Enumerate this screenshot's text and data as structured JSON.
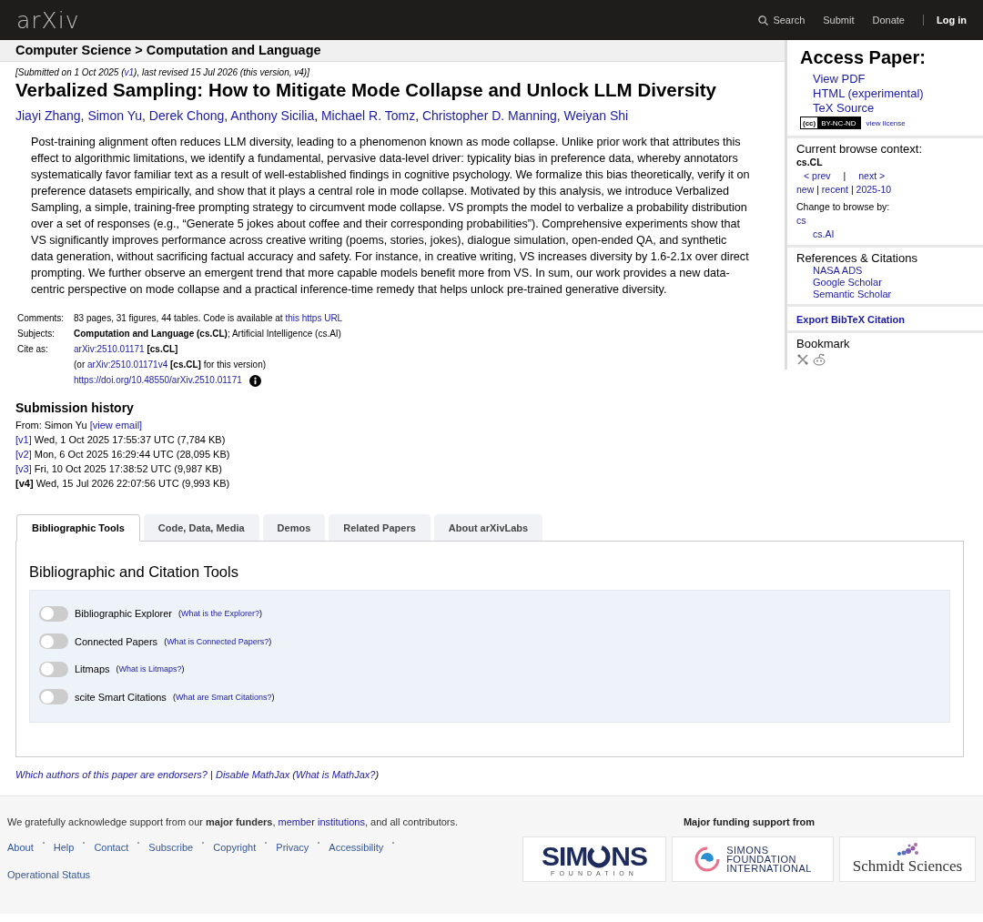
{
  "header": {
    "logo": "arXiv",
    "nav": [
      {
        "label": "Search",
        "kind": "search"
      },
      {
        "label": "Submit",
        "kind": "link"
      },
      {
        "label": "Donate",
        "kind": "link"
      },
      {
        "label": "Log in",
        "kind": "login"
      }
    ]
  },
  "breadcrumb": "Computer Science > Computation and Language",
  "submitted": [
    {
      "kind": "text",
      "text": "[Submitted on 1 Oct 2025 ("
    },
    {
      "kind": "link",
      "text": "v1"
    },
    {
      "kind": "text",
      "text": "), last revised 15 Jul 2026 (this version, v4)]"
    }
  ],
  "title": "Verbalized Sampling: How to Mitigate Mode Collapse and Unlock LLM Diversity",
  "authors": [
    {
      "kind": "link",
      "text": "Jiayi Zhang"
    },
    {
      "kind": "text",
      "text": ", "
    },
    {
      "kind": "link",
      "text": "Simon Yu"
    },
    {
      "kind": "text",
      "text": ", "
    },
    {
      "kind": "link",
      "text": "Derek Chong"
    },
    {
      "kind": "text",
      "text": ", "
    },
    {
      "kind": "link",
      "text": "Anthony Sicilia"
    },
    {
      "kind": "text",
      "text": ", "
    },
    {
      "kind": "link",
      "text": "Michael R. Tomz"
    },
    {
      "kind": "text",
      "text": ", "
    },
    {
      "kind": "link",
      "text": "Christopher D. Manning"
    },
    {
      "kind": "text",
      "text": ", "
    },
    {
      "kind": "link",
      "text": "Weiyan Shi"
    }
  ],
  "abstract": "Post-training alignment often reduces LLM diversity, leading to a phenomenon known as mode collapse. Unlike prior work that attributes this effect to algorithmic limitations, we identify a fundamental, pervasive data-level driver: typicality bias in preference data, whereby annotators systematically favor familiar text as a result of well-established findings in cognitive psychology. We formalize this bias theoretically, verify it on preference datasets empirically, and show that it plays a central role in mode collapse. Motivated by this analysis, we introduce Verbalized Sampling, a simple, training-free prompting strategy to circumvent mode collapse. VS prompts the model to verbalize a probability distribution over a set of responses (e.g., “Generate 5 jokes about coffee and their corresponding probabilities”). Comprehensive experiments show that VS significantly improves performance across creative writing (poems, stories, jokes), dialogue simulation, open-ended QA, and synthetic data generation, without sacrificing factual accuracy and safety. For instance, in creative writing, VS increases diversity by 1.6-2.1x over direct prompting. We further observe an emergent trend that more capable models benefit more from VS. In sum, our work provides a new data-centric perspective on mode collapse and a practical inference-time remedy that helps unlock pre-trained generative diversity.",
  "metadata": [
    {
      "label": "Comments:",
      "lines": [
        [
          {
            "kind": "text",
            "text": "83 pages, 31 figures, 44 tables. Code is available at "
          },
          {
            "kind": "link",
            "text": "this https URL"
          }
        ]
      ]
    },
    {
      "label": "Subjects:",
      "lines": [
        [
          {
            "kind": "text",
            "text": "**Computation and Language (cs.CL)**; Artificial Intelligence (cs.AI)"
          }
        ]
      ]
    },
    {
      "label": "Cite as:",
      "lines": [
        [
          {
            "kind": "link",
            "text": "arXiv:2510.01171"
          },
          {
            "kind": "text",
            "text": " **[cs.CL]**"
          }
        ],
        [
          {
            "kind": "text",
            "text": "(or "
          },
          {
            "kind": "link",
            "text": "arXiv:2510.01171v4"
          },
          {
            "kind": "text",
            "text": " **[cs.CL]** for this version)"
          }
        ],
        [
          {
            "kind": "link",
            "text": "https://doi.org/10.48550/arXiv.2510.01171"
          },
          {
            "kind": "info"
          }
        ]
      ]
    }
  ],
  "history": {
    "title": "Submission history",
    "from": [
      {
        "kind": "text",
        "text": "From: Simon Yu "
      },
      {
        "kind": "link",
        "text": "[view email]"
      }
    ],
    "versions": [
      {
        "version": "[v1]",
        "current": false,
        "details": "Wed, 1 Oct 2025 17:55:37 UTC (7,784 KB)"
      },
      {
        "version": "[v2]",
        "current": false,
        "details": "Mon, 6 Oct 2025 16:29:44 UTC (28,095 KB)"
      },
      {
        "version": "[v3]",
        "current": false,
        "details": "Fri, 10 Oct 2025 17:38:52 UTC (9,987 KB)"
      },
      {
        "version": "[v4]",
        "current": true,
        "details": "Wed, 15 Jul 2026 22:07:56 UTC (9,993 KB)"
      }
    ]
  },
  "tabs": [
    {
      "label": "Bibliographic Tools",
      "selected": true
    },
    {
      "label": "Code, Data, Media",
      "selected": false
    },
    {
      "label": "Demos",
      "selected": false
    },
    {
      "label": "Related Papers",
      "selected": false
    },
    {
      "label": "About arXivLabs",
      "selected": false
    }
  ],
  "tools": {
    "title": "Bibliographic and Citation Tools",
    "items": [
      {
        "name": "Bibliographic Explorer",
        "help": [
          {
            "kind": "text",
            "text": "("
          },
          {
            "kind": "link",
            "text": "What is the Explorer?"
          },
          {
            "kind": "text",
            "text": ")"
          }
        ],
        "on": false
      },
      {
        "name": "Connected Papers",
        "help": [
          {
            "kind": "text",
            "text": "("
          },
          {
            "kind": "link",
            "text": "What is Connected Papers?"
          },
          {
            "kind": "text",
            "text": ")"
          }
        ],
        "on": false
      },
      {
        "name": "Litmaps",
        "help": [
          {
            "kind": "text",
            "text": "("
          },
          {
            "kind": "link",
            "text": "What is Litmaps?"
          },
          {
            "kind": "text",
            "text": ")"
          }
        ],
        "on": false
      },
      {
        "name": "scite Smart Citations",
        "help": [
          {
            "kind": "text",
            "text": "("
          },
          {
            "kind": "link",
            "text": "What are Smart Citations?"
          },
          {
            "kind": "text",
            "text": ")"
          }
        ],
        "on": false
      }
    ]
  },
  "bottom_links": [
    {
      "kind": "link",
      "text": "Which authors of this paper are endorsers?"
    },
    {
      "kind": "text",
      "text": " | "
    },
    {
      "kind": "link",
      "text": "Disable MathJax"
    },
    {
      "kind": "text",
      "text": " ("
    },
    {
      "kind": "link",
      "text": "What is MathJax?"
    },
    {
      "kind": "text",
      "text": ")"
    }
  ],
  "sidebar": {
    "access": {
      "title": "Access Paper:",
      "links": [
        "View PDF",
        "HTML (experimental)",
        "TeX Source"
      ],
      "badge_cc": "(cc)",
      "badge_terms": "BY-NC-ND",
      "license_link": "view license"
    },
    "browse": {
      "title": "Current browse context:",
      "context": "cs.CL",
      "prev": "< prev",
      "separator": "|",
      "next": "next >",
      "periods": [
        {
          "kind": "link",
          "text": "new"
        },
        {
          "kind": "text",
          "text": " | "
        },
        {
          "kind": "link",
          "text": "recent"
        },
        {
          "kind": "text",
          "text": " | "
        },
        {
          "kind": "link",
          "text": "2025-10"
        }
      ],
      "change_label": "Change to browse by:",
      "categories": [
        "cs",
        "cs.AI"
      ]
    },
    "references": {
      "title": "References & Citations",
      "links": [
        "NASA ADS",
        "Google Scholar",
        "Semantic Scholar"
      ]
    },
    "export": "Export BibTeX Citation",
    "bookmark": {
      "title": "Bookmark"
    }
  },
  "footer": {
    "ack": [
      {
        "kind": "text",
        "text": "We gratefully acknowledge support from our **major funders**, "
      },
      {
        "kind": "link",
        "text": "member institutions"
      },
      {
        "kind": "text",
        "text": ", and all contributors."
      }
    ],
    "links": [
      "About",
      "Help",
      "Contact",
      "Subscribe",
      "Copyright",
      "Privacy",
      "Accessibility",
      "Operational Status"
    ],
    "funding_title": "Major funding support from",
    "logos": [
      {
        "kind": "simons",
        "lines": [
          "SIM",
          "NS",
          "FOUNDATION"
        ]
      },
      {
        "kind": "sfi",
        "lines": [
          "SIMONS",
          "FOUNDATION",
          "INTERNATIONAL"
        ]
      },
      {
        "kind": "schmidt",
        "lines": [
          "Schmidt Sciences"
        ]
      }
    ]
  }
}
